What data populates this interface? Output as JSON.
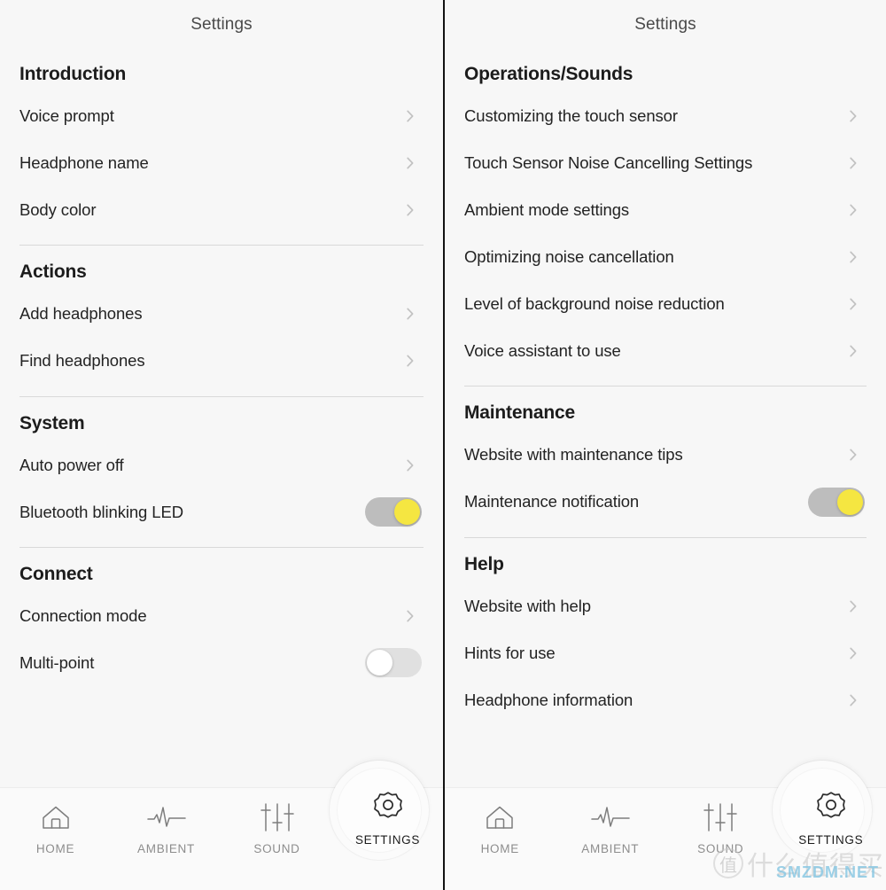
{
  "app": {
    "header_title": "Settings",
    "accent_toggle_on_color": "#f5e641",
    "toggle_track_on_color": "#bdbdbd",
    "toggle_track_off_color": "#e0e0e0",
    "background_color": "#f7f7f7",
    "watermark_badge": "值",
    "watermark_text": "什么值得买",
    "watermark_site": "SMZDM.NET"
  },
  "left_panel": {
    "header_title": "Settings",
    "sections": [
      {
        "title": "Introduction",
        "rows": [
          {
            "label": "Voice prompt",
            "control": "chevron"
          },
          {
            "label": "Headphone name",
            "control": "chevron"
          },
          {
            "label": "Body color",
            "control": "chevron"
          }
        ]
      },
      {
        "title": "Actions",
        "rows": [
          {
            "label": "Add headphones",
            "control": "chevron"
          },
          {
            "label": "Find headphones",
            "control": "chevron"
          }
        ]
      },
      {
        "title": "System",
        "rows": [
          {
            "label": "Auto power off",
            "control": "chevron"
          },
          {
            "label": "Bluetooth blinking LED",
            "control": "toggle",
            "state": "on"
          }
        ]
      },
      {
        "title": "Connect",
        "rows": [
          {
            "label": "Connection mode",
            "control": "chevron"
          },
          {
            "label": "Multi-point",
            "control": "toggle",
            "state": "off"
          }
        ]
      }
    ]
  },
  "right_panel": {
    "header_title": "Settings",
    "sections": [
      {
        "title": "Operations/Sounds",
        "rows": [
          {
            "label": "Customizing the touch sensor",
            "control": "chevron"
          },
          {
            "label": "Touch Sensor Noise Cancelling Settings",
            "control": "chevron"
          },
          {
            "label": "Ambient mode settings",
            "control": "chevron"
          },
          {
            "label": "Optimizing noise cancellation",
            "control": "chevron"
          },
          {
            "label": "Level of background noise reduction",
            "control": "chevron"
          },
          {
            "label": "Voice assistant to use",
            "control": "chevron"
          }
        ]
      },
      {
        "title": "Maintenance",
        "rows": [
          {
            "label": "Website with maintenance tips",
            "control": "chevron"
          },
          {
            "label": "Maintenance notification",
            "control": "toggle",
            "state": "on"
          }
        ]
      },
      {
        "title": "Help",
        "rows": [
          {
            "label": "Website with help",
            "control": "chevron"
          },
          {
            "label": "Hints for use",
            "control": "chevron"
          },
          {
            "label": "Headphone information",
            "control": "chevron"
          }
        ]
      }
    ]
  },
  "bottom_nav": {
    "active": "SETTINGS",
    "items": [
      {
        "label": "HOME",
        "icon": "home-icon"
      },
      {
        "label": "AMBIENT",
        "icon": "waveform-icon"
      },
      {
        "label": "SOUND",
        "icon": "sliders-icon"
      },
      {
        "label": "SETTINGS",
        "icon": "gear-icon"
      }
    ]
  }
}
